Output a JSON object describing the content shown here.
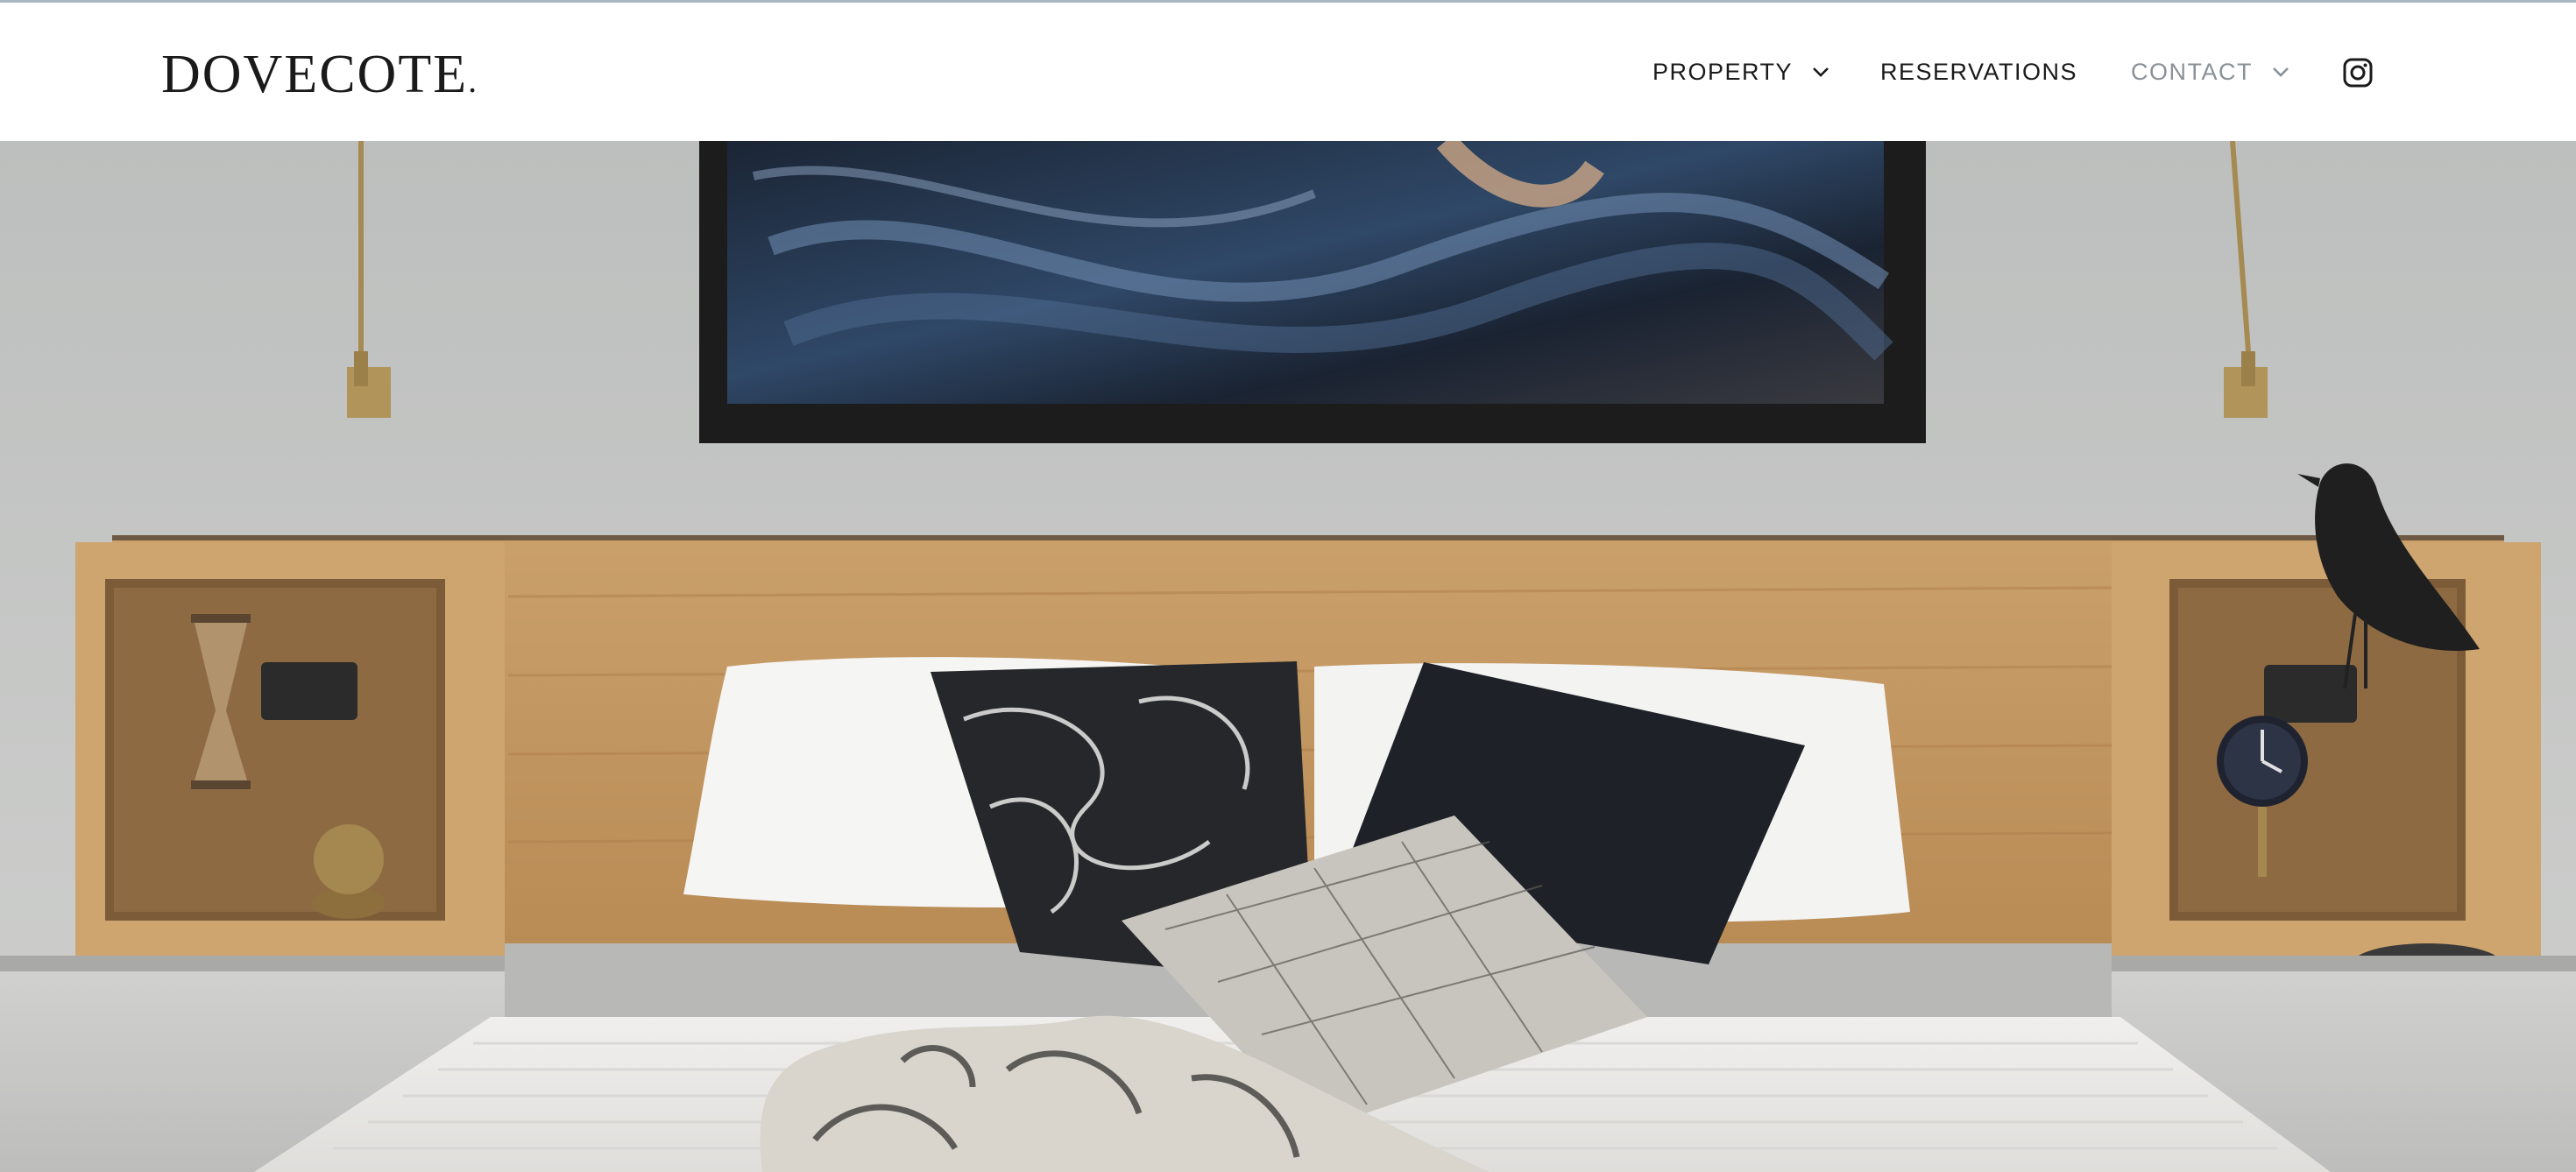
{
  "header": {
    "logo_text": "DOVECOTE",
    "logo_dot": "."
  },
  "nav": {
    "items": [
      {
        "label": "PROPERTY",
        "has_dropdown": true,
        "active": false
      },
      {
        "label": "RESERVATIONS",
        "has_dropdown": false,
        "active": false
      },
      {
        "label": "CONTACT",
        "has_dropdown": true,
        "active": true
      }
    ],
    "social_icon": "instagram-icon"
  },
  "hero": {
    "image": "bedroom-hero-image"
  },
  "colors": {
    "top_border": "#a9b7c2",
    "text": "#1a1a1a",
    "active_nav": "#8a9198",
    "wall": "#c4c5c4",
    "oak": "#c69a62"
  }
}
